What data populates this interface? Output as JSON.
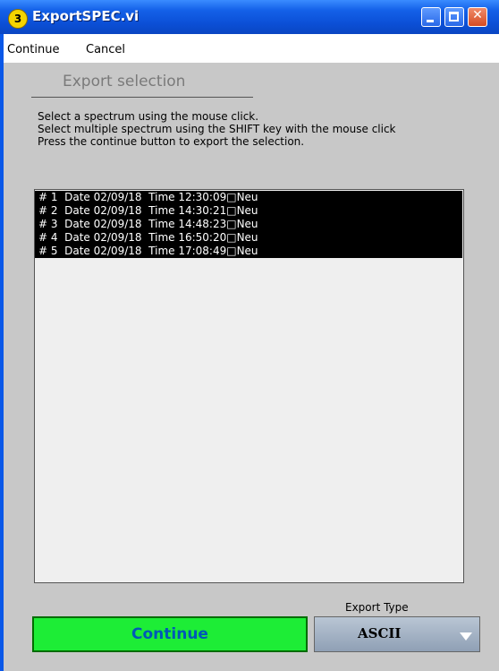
{
  "window": {
    "title": "ExportSPEC.vi",
    "app_icon_glyph": "3",
    "accent_color": "#0a58e8"
  },
  "menu": {
    "items": [
      "Continue",
      "Cancel"
    ]
  },
  "section": {
    "title": "Export selection"
  },
  "instructions": [
    "Select a spectrum using the mouse click.",
    "Select multiple spectrum using the SHIFT key with the mouse click",
    "Press the continue button to export the selection."
  ],
  "spectra": [
    "# 1  Date 02/09/18  Time 12:30:09□Neu",
    "# 2  Date 02/09/18  Time 14:30:21□Neu",
    "# 3  Date 02/09/18  Time 14:48:23□Neu",
    "# 4  Date 02/09/18  Time 16:50:20□Neu",
    "# 5  Date 02/09/18  Time 17:08:49□Neu"
  ],
  "controls": {
    "continue_label": "Continue",
    "continue_color": "#1ded36",
    "export_type_label": "Export Type",
    "export_type_value": "ASCII"
  },
  "icons": {
    "minimize": "minimize-icon",
    "maximize": "maximize-icon",
    "close": "close-icon",
    "scroll_up": "scroll-up-arrow-icon",
    "scroll_down": "scroll-down-arrow-icon",
    "dropdown": "dropdown-arrow-icon"
  }
}
